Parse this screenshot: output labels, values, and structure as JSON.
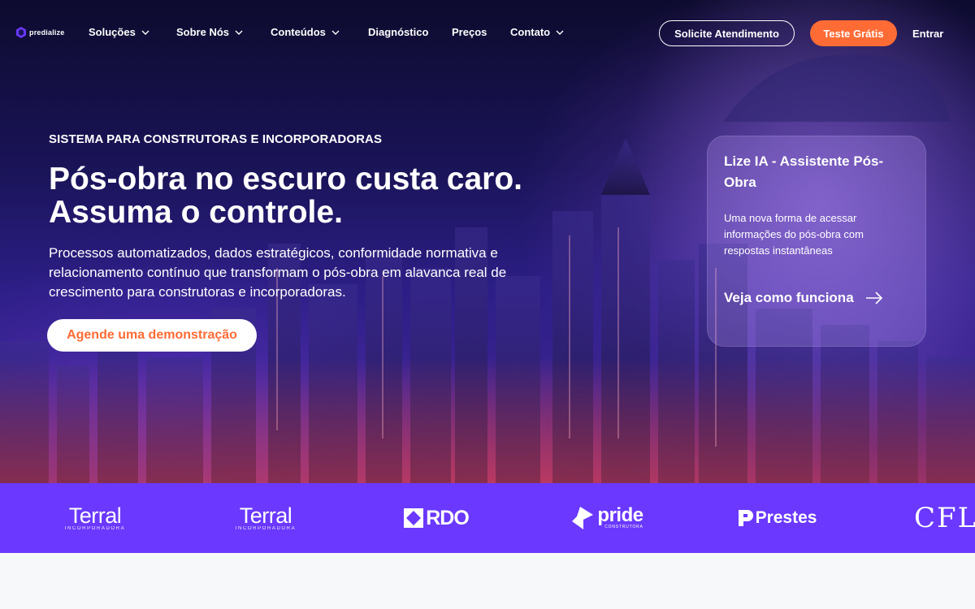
{
  "brand": {
    "name": "predialize"
  },
  "nav": {
    "items": [
      {
        "label": "Soluções",
        "dropdown": true
      },
      {
        "label": "Sobre Nós",
        "dropdown": true
      },
      {
        "label": "Conteúdos",
        "dropdown": true
      },
      {
        "label": "Diagnóstico",
        "dropdown": false
      },
      {
        "label": "Preços",
        "dropdown": false
      },
      {
        "label": "Contato",
        "dropdown": true
      }
    ],
    "solicite_label": "Solicite Atendimento",
    "teste_label": "Teste Grátis",
    "entrar_label": "Entrar"
  },
  "hero": {
    "eyebrow": "SISTEMA PARA CONSTRUTORAS E INCORPORADORAS",
    "headline_line1": "Pós-obra no escuro custa caro.",
    "headline_line2": "Assuma o controle.",
    "subtitle": "Processos automatizados, dados estratégicos, conformidade normativa e relacionamento contínuo que transformam o pós-obra em alavanca real de crescimento para construtoras e incorporadoras.",
    "cta_label": "Agende uma demonstração"
  },
  "ai_card": {
    "title": "Lize IA - Assistente Pós-Obra",
    "description": "Uma nova forma de acessar informações do pós-obra com respostas instantâneas",
    "link_label": "Veja como funciona"
  },
  "clients": {
    "terral_name": "Terral",
    "terral_sub": "INCORPORADORA",
    "rdo": "RDO",
    "pride": "pride",
    "pride_sub": "CONSTRUTORA",
    "prestes": "Prestes",
    "cfl": "CFL"
  },
  "colors": {
    "accent_orange": "#ff6b35",
    "strip_purple": "#6a38ff",
    "hero_dark": "#1a1458"
  }
}
